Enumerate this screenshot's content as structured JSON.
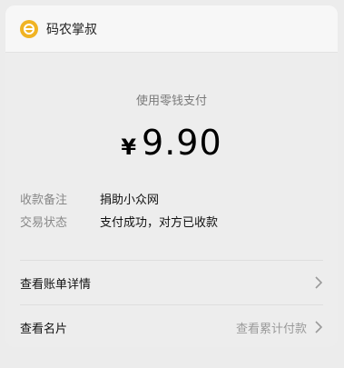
{
  "merchant": {
    "name": "码农掌叔"
  },
  "payment": {
    "method_label": "使用零钱支付",
    "currency_symbol": "¥",
    "amount": "9.90"
  },
  "details": [
    {
      "key": "收款备注",
      "value": "捐助小众网"
    },
    {
      "key": "交易状态",
      "value": "支付成功，对方已收款"
    }
  ],
  "links": {
    "bill_details": "查看账单详情",
    "card": "查看名片",
    "cumulative": "查看累计付款"
  },
  "colors": {
    "brand": "#f0b323"
  }
}
